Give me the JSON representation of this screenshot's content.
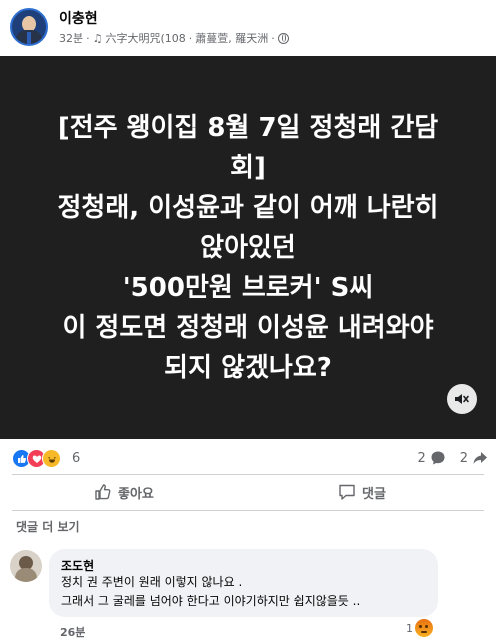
{
  "post": {
    "author": "이충현",
    "time": "32분",
    "music_note": "♫",
    "song": "六字大明咒(108",
    "artist": "蕭蔓萱, 羅天洲",
    "separator": "·"
  },
  "video": {
    "caption_lines": [
      "[전주 왱이집 8월 7일 정청래 간담",
      "회]",
      "정청래, 이성윤과 같이 어깨 나란히",
      "앉아있던",
      "'500만원 브로커' S씨",
      "이 정도면 정청래 이성윤 내려와야",
      "되지 않겠나요?"
    ]
  },
  "reactions": {
    "count": "6",
    "comments": "2",
    "shares": "2"
  },
  "actions": {
    "like_label": "좋아요",
    "comment_label": "댓글"
  },
  "comments": {
    "more_label": "댓글 더 보기",
    "items": [
      {
        "name": "조도현",
        "line1": "정치 권 주변이 원래 이렇지 않나요 .",
        "line2": "그래서 그 굴레를 넘어야 한다고 이야기하지만 쉽지않을듯 ..",
        "time": "26분",
        "reaction_count": "1"
      }
    ]
  },
  "colors": {
    "like_blue": "#1877f2",
    "love_red": "#f33e58",
    "haha_yellow": "#f7b928",
    "secondary_text": "#65676b",
    "video_bg": "#1f1f1f"
  }
}
